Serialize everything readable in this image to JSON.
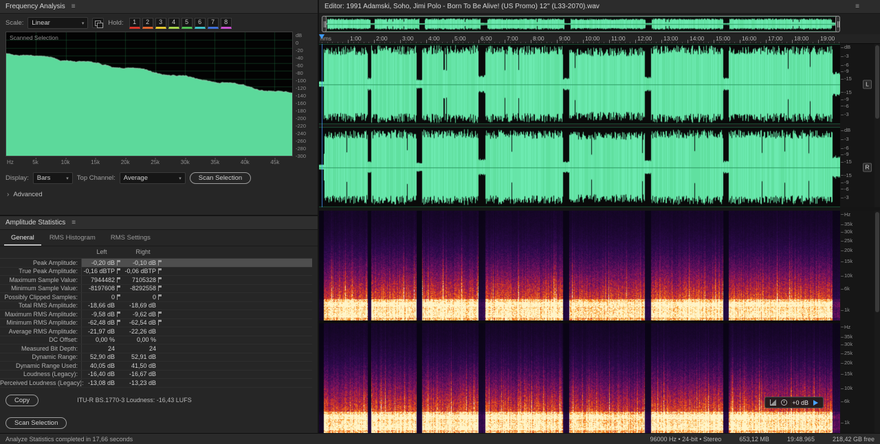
{
  "icons": {
    "panel_menu": "≡",
    "dropdown_chevron": "▾",
    "advanced_chevron": "›"
  },
  "colors": {
    "wave_green": "#60e0a0",
    "wave_green_alt": "#6ceab0",
    "center_line_green": "#2f9e66",
    "accent_blue": "#3f9af5"
  },
  "frequency_panel": {
    "title": "Frequency Analysis",
    "scale_label": "Scale:",
    "scale_value": "Linear",
    "hold_label": "Hold:",
    "hold_buttons": [
      {
        "label": "1",
        "color": "#d7342a"
      },
      {
        "label": "2",
        "color": "#e0652e"
      },
      {
        "label": "3",
        "color": "#e5c72e"
      },
      {
        "label": "4",
        "color": "#a8d54a"
      },
      {
        "label": "5",
        "color": "#4fc052"
      },
      {
        "label": "6",
        "color": "#3ec1c9"
      },
      {
        "label": "7",
        "color": "#3f6fd8"
      },
      {
        "label": "8",
        "color": "#c94fd0"
      }
    ],
    "graph_label": "Scanned Selection",
    "db_ticks": [
      "dB",
      "0",
      "-20",
      "-40",
      "-60",
      "-80",
      "-100",
      "-120",
      "-140",
      "-160",
      "-180",
      "-200",
      "-220",
      "-240",
      "-260",
      "-280",
      "-300"
    ],
    "freq_ticks": [
      "5k",
      "10k",
      "15k",
      "20k",
      "25k",
      "30k",
      "35k",
      "40k",
      "45k"
    ],
    "freq_unit": "Hz",
    "display_label": "Display:",
    "display_value": "Bars",
    "top_channel_label": "Top Channel:",
    "top_channel_value": "Average",
    "scan_button": "Scan Selection",
    "advanced_label": "Advanced"
  },
  "amplitude_panel": {
    "title": "Amplitude Statistics",
    "tabs": [
      "General",
      "RMS Histogram",
      "RMS Settings"
    ],
    "columns": {
      "left": "Left",
      "right": "Right"
    },
    "rows": [
      {
        "label": "Peak Amplitude:",
        "left": "-0,20 dB",
        "right": "-0,10 dB",
        "arrows": true,
        "highlight": true
      },
      {
        "label": "True Peak Amplitude:",
        "left": "-0,16 dBTP",
        "right": "-0,06 dBTP",
        "arrows": true
      },
      {
        "label": "Maximum Sample Value:",
        "left": "7944482",
        "right": "7105328",
        "arrows": true
      },
      {
        "label": "Minimum Sample Value:",
        "left": "-8197608",
        "right": "-8292558",
        "arrows": true
      },
      {
        "label": "Possibly Clipped Samples:",
        "left": "0",
        "right": "0",
        "arrows": true
      },
      {
        "label": "Total RMS Amplitude:",
        "left": "-18,66 dB",
        "right": "-18,69 dB",
        "arrows": false
      },
      {
        "label": "Maximum RMS Amplitude:",
        "left": "-9,58 dB",
        "right": "-9,62 dB",
        "arrows": true
      },
      {
        "label": "Minimum RMS Amplitude:",
        "left": "-62,48 dB",
        "right": "-62,54 dB",
        "arrows": true
      },
      {
        "label": "Average RMS Amplitude:",
        "left": "-21,97 dB",
        "right": "-22,26 dB",
        "arrows": false
      },
      {
        "label": "DC Offset:",
        "left": "0,00 %",
        "right": "0,00 %",
        "arrows": false
      },
      {
        "label": "Measured Bit Depth:",
        "left": "24",
        "right": "24",
        "arrows": false
      },
      {
        "label": "Dynamic Range:",
        "left": "52,90 dB",
        "right": "52,91 dB",
        "arrows": false
      },
      {
        "label": "Dynamic Range Used:",
        "left": "40,05 dB",
        "right": "41,50 dB",
        "arrows": false
      },
      {
        "label": "Loudness (Legacy):",
        "left": "-16,40 dB",
        "right": "-16,67 dB",
        "arrows": false
      },
      {
        "label": "Perceived Loudness (Legacy):",
        "left": "-13,08 dB",
        "right": "-13,23 dB",
        "arrows": false
      }
    ],
    "copy_button": "Copy",
    "loudness_info": "ITU-R BS.1770-3 Loudness:  -16,43 LUFS",
    "scan_button": "Scan Selection"
  },
  "editor": {
    "title": "Editor: 1991 Adamski, Soho, Jimi Polo - Born To Be Alive! (US Promo) 12'' (L33-2070).wav",
    "timeline_unit": "hms",
    "timeline_ticks": [
      "1:00",
      "2:00",
      "3:00",
      "4:00",
      "5:00",
      "6:00",
      "7:00",
      "8:00",
      "9:00",
      "10:00",
      "11:00",
      "12:00",
      "13:00",
      "14:00",
      "15:00",
      "16:00",
      "17:00",
      "18:00",
      "19:00"
    ],
    "wave_db_labels": [
      "dB",
      "-3",
      "-6",
      "-9",
      "-15",
      "-15",
      "-9",
      "-6",
      "-3"
    ],
    "channel_badges": [
      "L",
      "R"
    ],
    "spec_hz_labels": [
      "Hz",
      "35k",
      "30k",
      "25k",
      "20k",
      "15k",
      "10k",
      "6k",
      "1k"
    ],
    "hud_gain": "+0 dB"
  },
  "status_bar": {
    "analyze_text": "Analyze Statistics completed in 17,66 seconds",
    "sample_info": "96000 Hz • 24-bit • Stereo",
    "file_size": "653,12 MB",
    "duration": "19:48.965",
    "free_space": "218,42 GB free"
  }
}
